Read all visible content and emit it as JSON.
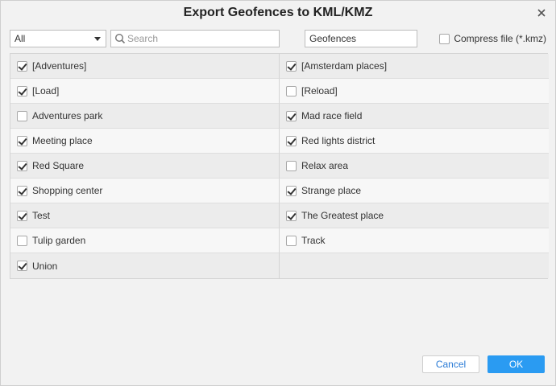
{
  "dialog": {
    "title": "Export Geofences to KML/KMZ"
  },
  "toolbar": {
    "filter_value": "All",
    "search_placeholder": "Search",
    "search_value": "",
    "file_name_value": "Geofences",
    "compress_label": "Compress file (*.kmz)",
    "compress_checked": false
  },
  "geofences": [
    {
      "label": "[Adventures]",
      "checked": true
    },
    {
      "label": "[Amsterdam places]",
      "checked": true
    },
    {
      "label": "[Load]",
      "checked": true
    },
    {
      "label": "[Reload]",
      "checked": false
    },
    {
      "label": "Adventures park",
      "checked": false
    },
    {
      "label": "Mad race field",
      "checked": true
    },
    {
      "label": "Meeting place",
      "checked": true
    },
    {
      "label": "Red lights district",
      "checked": true
    },
    {
      "label": "Red Square",
      "checked": true
    },
    {
      "label": "Relax area",
      "checked": false
    },
    {
      "label": "Shopping center",
      "checked": true
    },
    {
      "label": "Strange place",
      "checked": true
    },
    {
      "label": "Test",
      "checked": true
    },
    {
      "label": "The Greatest place",
      "checked": true
    },
    {
      "label": "Tulip garden",
      "checked": false
    },
    {
      "label": "Track",
      "checked": false
    },
    {
      "label": "Union",
      "checked": true
    }
  ],
  "buttons": {
    "cancel_label": "Cancel",
    "ok_label": "OK"
  },
  "colors": {
    "accent": "#2a9bf2",
    "link": "#2a7bd6"
  },
  "icons": {
    "close": "close-icon",
    "search": "search-icon",
    "dropdown": "chevron-down-icon"
  }
}
